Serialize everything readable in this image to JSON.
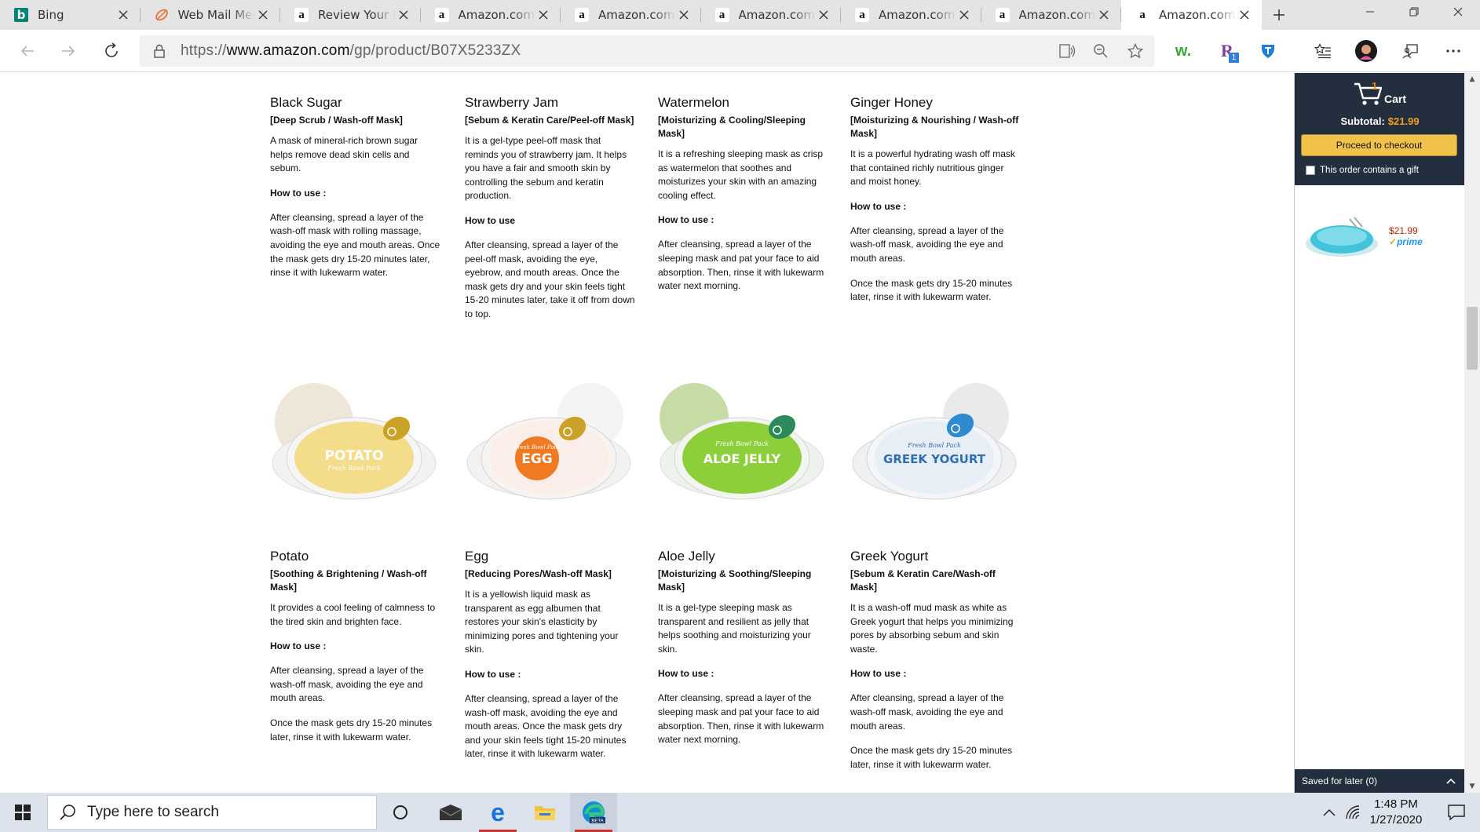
{
  "tabs": [
    {
      "icon": "bing",
      "title": "Bing"
    },
    {
      "icon": "webmail",
      "title": "Web Mail Message"
    },
    {
      "icon": "amazon",
      "title": "Review Your Purchase"
    },
    {
      "icon": "amazon",
      "title": "Amazon.com: N"
    },
    {
      "icon": "amazon",
      "title": "Amazon.com :"
    },
    {
      "icon": "amazon",
      "title": "Amazon.com: A"
    },
    {
      "icon": "amazon",
      "title": "Amazon.com :"
    },
    {
      "icon": "amazon",
      "title": "Amazon.com: L"
    },
    {
      "icon": "amazon",
      "title": "Amazon.com :"
    }
  ],
  "address": {
    "prefix": "https://",
    "host": "www.amazon.com",
    "path": "/gp/product/B07X5233ZX"
  },
  "extensions": {
    "w_label": "w.",
    "r_badge": "1"
  },
  "products": [
    {
      "name": "Black Sugar",
      "type": "[Deep Scrub / Wash-off Mask]",
      "desc": "A mask of mineral-rich brown sugar helps remove dead skin cells and sebum.",
      "howto": "How to use :",
      "steps": [
        "After cleansing, spread a layer of the wash-off mask with rolling massage, avoiding the eye and mouth areas. Once the mask gets dry 15-20 minutes later, rinse it with lukewarm water."
      ]
    },
    {
      "name": "Strawberry Jam",
      "type": "[Sebum & Keratin Care/Peel-off Mask]",
      "desc": "It is a gel-type peel-off mask that reminds you of strawberry jam. It helps you have a fair and smooth skin by controlling the sebum and keratin production.",
      "howto": "How to use",
      "steps": [
        "After cleansing, spread a layer of the peel-off mask, avoiding the eye, eyebrow, and mouth areas. Once the mask gets dry and your skin feels tight 15-20 minutes later, take it off from down to top."
      ]
    },
    {
      "name": "Watermelon",
      "type": "[Moisturizing & Cooling/Sleeping Mask]",
      "desc": "It is a refreshing sleeping mask as crisp as watermelon that soothes and moisturizes your skin with an amazing cooling effect.",
      "howto": "How to use :",
      "steps": [
        "After cleansing, spread a layer of the sleeping mask and pat your face to aid absorption. Then, rinse it with lukewarm water next morning."
      ]
    },
    {
      "name": "Ginger Honey",
      "type": "[Moisturizing & Nourishing / Wash-off Mask]",
      "desc": "It is a powerful hydrating wash off mask that contained richly nutritious ginger and moist honey.",
      "howto": "How to use :",
      "steps": [
        "After cleansing, spread a layer of the wash-off mask, avoiding the eye and mouth areas.",
        "Once the mask gets dry 15-20 minutes later, rinse it with lukewarm water."
      ]
    },
    {
      "name": "Potato",
      "type": "[Soothing & Brightening / Wash-off Mask]",
      "desc": "It provides a cool feeling of calmness to the tired skin and brighten face.",
      "howto": "How to use :",
      "steps": [
        "After cleansing, spread a layer of the wash-off mask, avoiding the eye and mouth areas.",
        "Once the mask gets dry 15-20 minutes later, rinse it with lukewarm water."
      ],
      "image": {
        "label": "POTATO",
        "sub": "Fresh Bowl Pack",
        "color": "#f3dc8a",
        "accent": "#c9a227"
      }
    },
    {
      "name": "Egg",
      "type": "[Reducing Pores/Wash-off Mask]",
      "desc": "It is a yellowish liquid mask as transparent as egg albumen that restores your skin's elasticity by minimizing pores and tightening your skin.",
      "howto": "How to use :",
      "steps": [
        "After cleansing, spread a layer of the wash-off mask, avoiding the eye and mouth areas. Once the mask gets dry and your skin feels tight 15-20 minutes later, rinse it with lukewarm water."
      ],
      "image": {
        "label": "EGG",
        "sub": "Fresh Bowl Pack",
        "color": "#f07a22",
        "accent": "#c9a227"
      }
    },
    {
      "name": "Aloe Jelly",
      "type": "[Moisturizing & Soothing/Sleeping Mask]",
      "desc": "It is a gel-type sleeping mask as transparent and resilient as jelly that helps soothing and moisturizing your skin.",
      "howto": "How to use :",
      "steps": [
        "After cleansing, spread a layer of the sleeping mask and pat your face to aid absorption. Then, rinse it with lukewarm water next morning."
      ],
      "image": {
        "label": "ALOE JELLY",
        "sub": "Fresh Bowl Pack",
        "color": "#8ccf3a",
        "accent": "#2d8a5a"
      }
    },
    {
      "name": "Greek Yogurt",
      "type": "[Sebum & Keratin Care/Wash-off Mask]",
      "desc": "It is a wash-off mud mask as white as Greek yogurt that helps you minimizing pores by absorbing sebum and skin waste.",
      "howto": "How to use :",
      "steps": [
        "After cleansing, spread a layer of the wash-off mask, avoiding the eye and mouth areas.",
        "Once the mask gets dry 15-20 minutes later, rinse it with lukewarm water."
      ],
      "image": {
        "label": "GREEK YOGURT",
        "sub": "Fresh Bowl Pack",
        "color": "#e8eef5",
        "accent": "#2f8ad0"
      }
    }
  ],
  "cart": {
    "count": "1",
    "label": "Cart",
    "subtotal_label": "Subtotal:",
    "subtotal_value": "$21.99",
    "checkout_label": "Proceed to checkout",
    "gift_label": "This order contains a gift",
    "item_price": "$21.99",
    "prime_label": "prime",
    "saved_label": "Saved for later (0)"
  },
  "taskbar": {
    "search_placeholder": "Type here to search",
    "time": "1:48 PM",
    "date": "1/27/2020"
  },
  "colors": {
    "amazon_dark": "#232f3e",
    "checkout_yellow": "#f0c14b",
    "price_red": "#b12704",
    "prime_blue": "#1a98ff"
  }
}
